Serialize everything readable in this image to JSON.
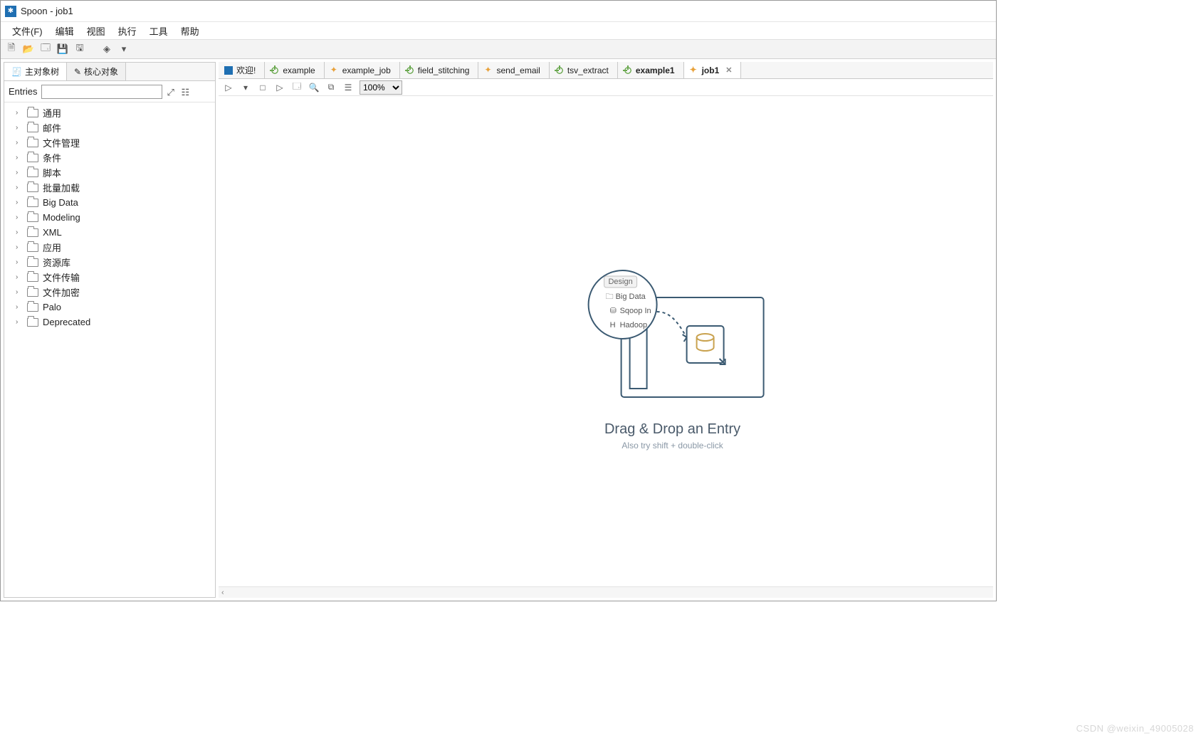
{
  "window": {
    "title": "Spoon - job1"
  },
  "menu": [
    "文件(F)",
    "编辑",
    "视图",
    "执行",
    "工具",
    "帮助"
  ],
  "sidebar": {
    "tabs": [
      {
        "label": "主对象树",
        "icon": "tree-icon"
      },
      {
        "label": "核心对象",
        "icon": "pencil-icon"
      }
    ],
    "entries_label": "Entries",
    "items": [
      "通用",
      "邮件",
      "文件管理",
      "条件",
      "脚本",
      "批量加载",
      "Big Data",
      "Modeling",
      "XML",
      "应用",
      "资源库",
      "文件传输",
      "文件加密",
      "Palo",
      "Deprecated"
    ]
  },
  "doc_tabs": [
    {
      "label": "欢迎!",
      "type": "app"
    },
    {
      "label": "example",
      "type": "trans"
    },
    {
      "label": "example_job",
      "type": "job"
    },
    {
      "label": "field_stitching",
      "type": "trans"
    },
    {
      "label": "send_email",
      "type": "job"
    },
    {
      "label": "tsv_extract",
      "type": "trans"
    },
    {
      "label": "example1",
      "type": "trans",
      "bold": true
    },
    {
      "label": "job1",
      "type": "job",
      "active": true,
      "closeable": true
    }
  ],
  "run_toolbar": {
    "zoom": "100%"
  },
  "hint": {
    "design_tab": "Design",
    "items": [
      "Big Data",
      "Sqoop In",
      "Hadoop"
    ],
    "title": "Drag & Drop an Entry",
    "sub": "Also try shift + double-click"
  },
  "watermark": "CSDN @weixin_49005028"
}
